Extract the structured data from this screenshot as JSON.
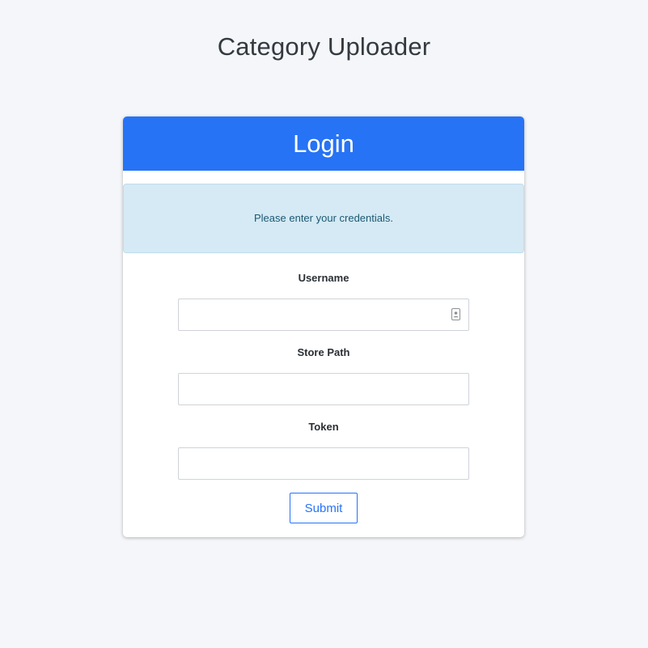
{
  "page": {
    "title": "Category Uploader"
  },
  "login_card": {
    "header": "Login",
    "alert_message": "Please enter your credentials.",
    "fields": [
      {
        "label": "Username",
        "value": "",
        "placeholder": "",
        "icon": "contact-card-icon"
      },
      {
        "label": "Store Path",
        "value": "",
        "placeholder": ""
      },
      {
        "label": "Token",
        "value": "",
        "placeholder": ""
      }
    ],
    "submit_label": "Submit"
  },
  "colors": {
    "background": "#f4f6f9",
    "primary": "#2673f5",
    "alert_background": "#d5eaf5",
    "alert_text": "#1c5872"
  }
}
